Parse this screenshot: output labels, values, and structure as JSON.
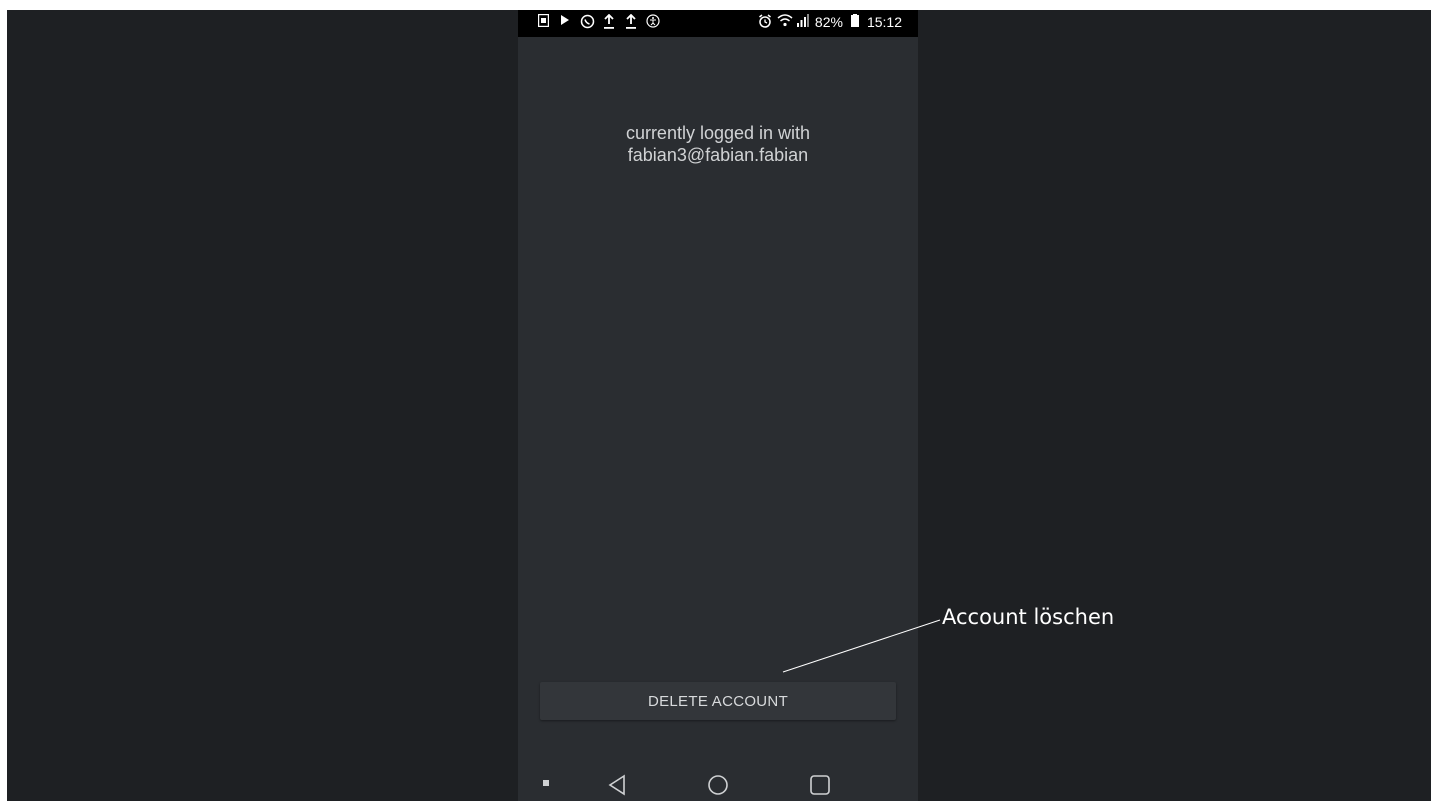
{
  "status_bar": {
    "battery": "82%",
    "time": "15:12",
    "left_icons": [
      "sim-icon",
      "play-icon",
      "whatsapp-icon",
      "upload-icon",
      "upload-icon",
      "accessibility-icon"
    ],
    "right_icons": [
      "alarm-icon",
      "wifi-icon",
      "signal-icon",
      "battery-icon"
    ]
  },
  "main": {
    "login_line1": "currently logged in with",
    "login_email": "fabian3@fabian.fabian"
  },
  "actions": {
    "delete_label": "DELETE ACCOUNT"
  },
  "annotation": {
    "label": "Account löschen"
  },
  "navigation": {
    "icons": [
      "back-icon",
      "home-icon",
      "recents-icon"
    ]
  },
  "colors": {
    "outer_background": "#1e2023",
    "app_background": "#2a2d31",
    "button_background": "#33363a",
    "status_bar": "#000000"
  }
}
